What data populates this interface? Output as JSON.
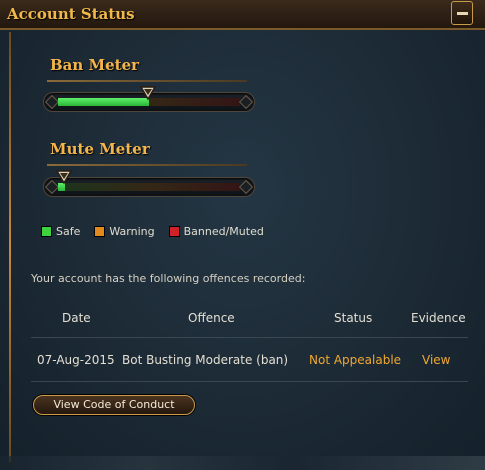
{
  "header": {
    "title": "Account Status"
  },
  "ban_meter": {
    "title": "Ban Meter",
    "level_fraction": 0.5
  },
  "mute_meter": {
    "title": "Mute Meter",
    "level_fraction": 0.04
  },
  "legend": [
    {
      "label": "Safe",
      "color": "#3fd23f"
    },
    {
      "label": "Warning",
      "color": "#e08a20"
    },
    {
      "label": "Banned/Muted",
      "color": "#d0202a"
    }
  ],
  "offences": {
    "intro": "Your account has the following offences recorded:",
    "columns": [
      "Date",
      "Offence",
      "Status",
      "Evidence"
    ],
    "rows": [
      {
        "date": "07-Aug-2015",
        "offence": "Bot Busting Moderate (ban)",
        "status": "Not Appealable",
        "evidence": "View"
      }
    ]
  },
  "conduct_button": {
    "label": "View Code of Conduct"
  },
  "colors": {
    "accent": "#f0b848",
    "link": "#f0a830",
    "meter_fill": "#3fd23f"
  }
}
